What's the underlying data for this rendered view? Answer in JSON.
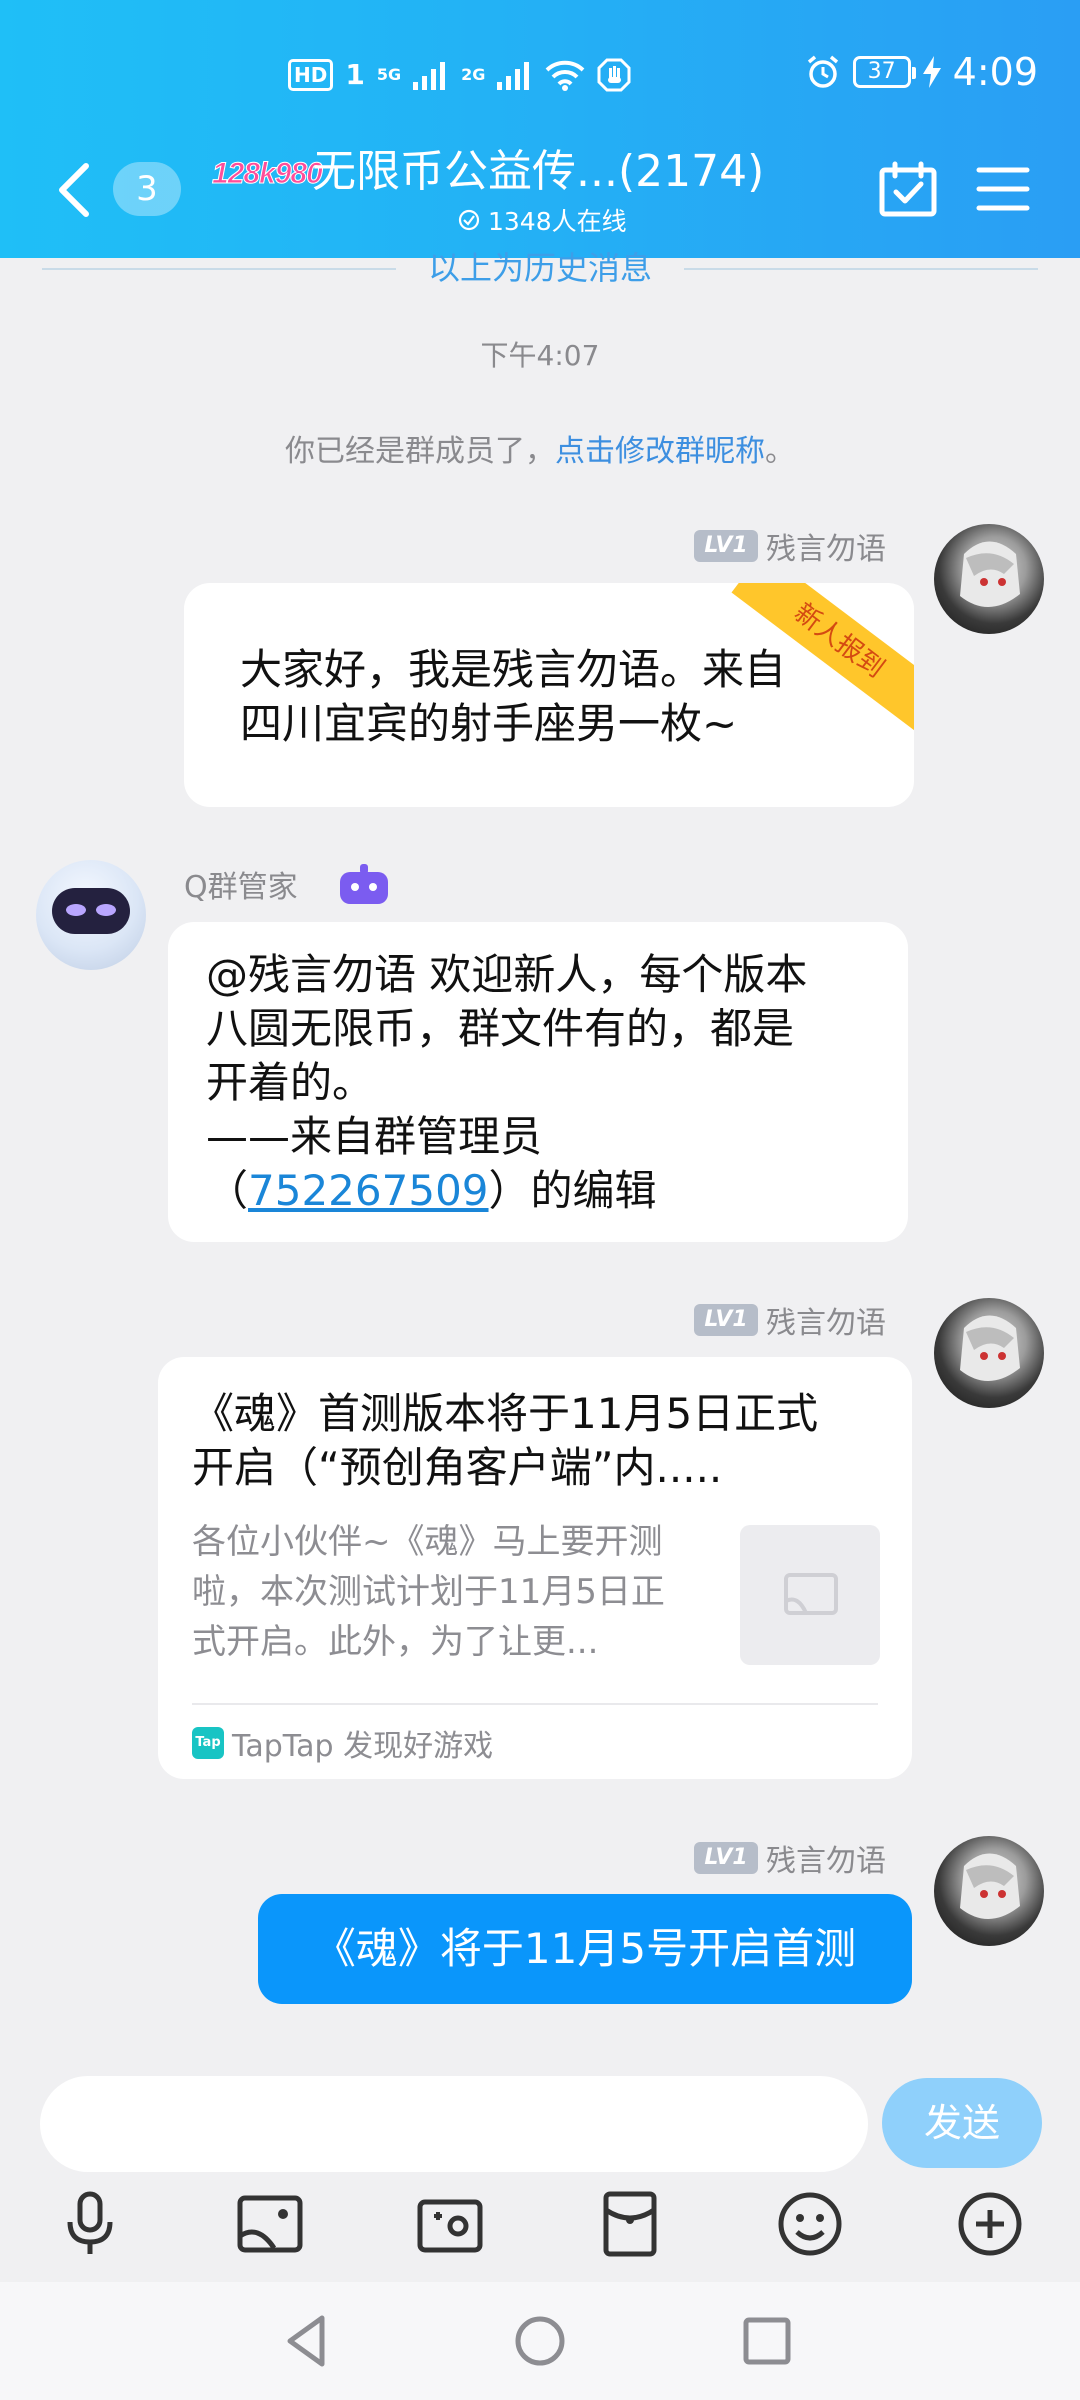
{
  "status_bar": {
    "hd": "HD",
    "sim1": "1",
    "net1": "5G",
    "net2": "2G",
    "battery": "37",
    "time": "4:09"
  },
  "header": {
    "unread_count": "3",
    "group_logo_text": "128k980",
    "group_title": "无限币公益传...(2174)",
    "online_text": "1348人在线",
    "icons": [
      "back-arrow",
      "calendar-check",
      "menu"
    ]
  },
  "chat": {
    "history_divider": "以上为历史消息",
    "timestamp": "下午4:07",
    "system_note_prefix": "你已经是群成员了，",
    "system_note_link": "点击修改群昵称",
    "system_note_suffix": "。",
    "messages": [
      {
        "sender": "残言勿语",
        "level": "LV1",
        "ribbon": "新人报到",
        "line1": "大家好，我是残言勿语。来自",
        "line2": "四川宜宾的射手座男一枚~"
      },
      {
        "sender": "Q群管家",
        "line1": "@残言勿语 欢迎新人，每个版本",
        "line2": "八圆无限币，群文件有的，都是",
        "line3": "开着的。",
        "line4": "——来自群管理员",
        "line5_prefix": "（",
        "line5_link": "752267509",
        "line5_suffix": "）的编辑"
      },
      {
        "sender": "残言勿语",
        "level": "LV1",
        "card_title_line1": "《魂》首测版本将于11月5日正式",
        "card_title_line2": "开启（“预创角客户端”内.....",
        "card_desc_line1": "各位小伙伴~《魂》马上要开测",
        "card_desc_line2": "啦，本次测试计划于11月5日正",
        "card_desc_line3": "式开启。此外，为了让更...",
        "card_source_logo": "Tap",
        "card_source": "TapTap 发现好游戏"
      },
      {
        "sender": "残言勿语",
        "level": "LV1",
        "text": "《魂》将于11月5号开启首测"
      }
    ]
  },
  "input": {
    "placeholder": "",
    "send_label": "发送"
  },
  "toolbar": {
    "icons": [
      "microphone",
      "image",
      "camera",
      "red-packet",
      "emoji",
      "plus"
    ]
  },
  "colors": {
    "header_gradient_start": "#1fbff7",
    "header_gradient_end": "#2a9ef4",
    "blue_bubble": "#0a96fb",
    "send_button": "#8fd0fb",
    "ribbon": "#ffc62b",
    "link": "#3d8fe0"
  }
}
